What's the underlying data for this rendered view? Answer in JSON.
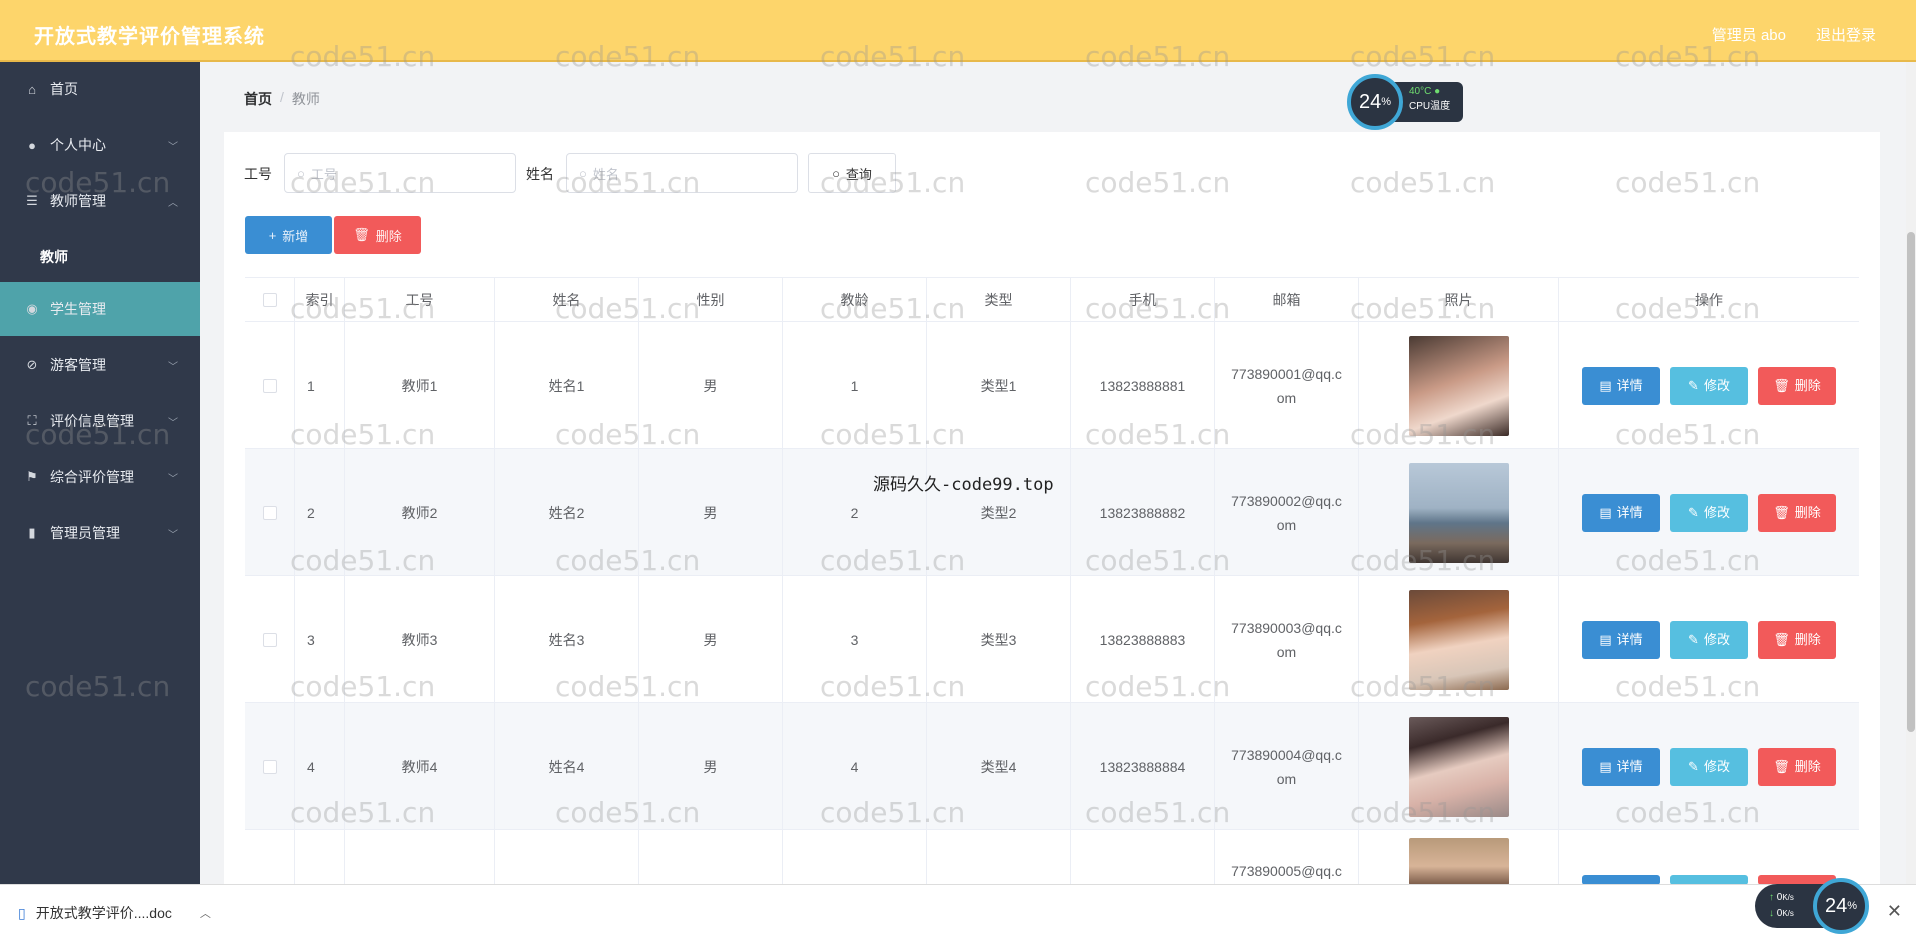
{
  "app": {
    "title": "开放式教学评价管理系统",
    "user_label": "管理员 abo",
    "logout_label": "退出登录"
  },
  "sidebar": {
    "items": [
      {
        "label": "首页",
        "icon": "home-icon"
      },
      {
        "label": "个人中心",
        "icon": "user-icon"
      },
      {
        "label": "教师管理",
        "icon": "list-icon"
      },
      {
        "label": "教师",
        "icon": ""
      },
      {
        "label": "学生管理",
        "icon": "student-icon"
      },
      {
        "label": "游客管理",
        "icon": "visitor-icon"
      },
      {
        "label": "评价信息管理",
        "icon": "evaluation-icon"
      },
      {
        "label": "综合评价管理",
        "icon": "flag-icon"
      },
      {
        "label": "管理员管理",
        "icon": "bar-chart-icon"
      }
    ]
  },
  "breadcrumb": {
    "home": "首页",
    "separator": "/",
    "current": "教师"
  },
  "search": {
    "id_label": "工号",
    "id_placeholder": "工号",
    "name_label": "姓名",
    "name_placeholder": "姓名",
    "query_label": "查询"
  },
  "toolbar": {
    "add_label": "新增",
    "delete_label": "删除"
  },
  "table": {
    "headers": [
      "索引",
      "工号",
      "姓名",
      "性别",
      "教龄",
      "类型",
      "手机",
      "邮箱",
      "照片",
      "操作"
    ],
    "rows": [
      {
        "index": "1",
        "id": "教师1",
        "name": "姓名1",
        "gender": "男",
        "years": "1",
        "type": "类型1",
        "phone": "13823888881",
        "email_1": "773890001@qq.c",
        "email_2": "om"
      },
      {
        "index": "2",
        "id": "教师2",
        "name": "姓名2",
        "gender": "男",
        "years": "2",
        "type": "类型2",
        "phone": "13823888882",
        "email_1": "773890002@qq.c",
        "email_2": "om"
      },
      {
        "index": "3",
        "id": "教师3",
        "name": "姓名3",
        "gender": "男",
        "years": "3",
        "type": "类型3",
        "phone": "13823888883",
        "email_1": "773890003@qq.c",
        "email_2": "om"
      },
      {
        "index": "4",
        "id": "教师4",
        "name": "姓名4",
        "gender": "男",
        "years": "4",
        "type": "类型4",
        "phone": "13823888884",
        "email_1": "773890004@qq.c",
        "email_2": "om"
      }
    ],
    "partial_row_email": "773890005@qq.c",
    "actions": {
      "detail": "详情",
      "edit": "修改",
      "delete": "删除"
    }
  },
  "widgets": {
    "cpu_percent": "24",
    "cpu_unit": "%",
    "cpu_temp": "40°C",
    "cpu_label": "CPU温度",
    "net_up": "0",
    "net_down": "0",
    "net_unit": "K/s",
    "net_percent": "24",
    "overlay_text": "源码久久-code99.top"
  },
  "download_bar": {
    "file_name": "开放式教学评价....doc"
  },
  "watermark": "code51.cn",
  "colors": {
    "header": "#fdd56b",
    "sidebar": "#30394a",
    "active_menu": "#4fa3aa",
    "primary": "#3a8ed3",
    "info": "#56bfe0",
    "danger": "#f25a5a"
  }
}
